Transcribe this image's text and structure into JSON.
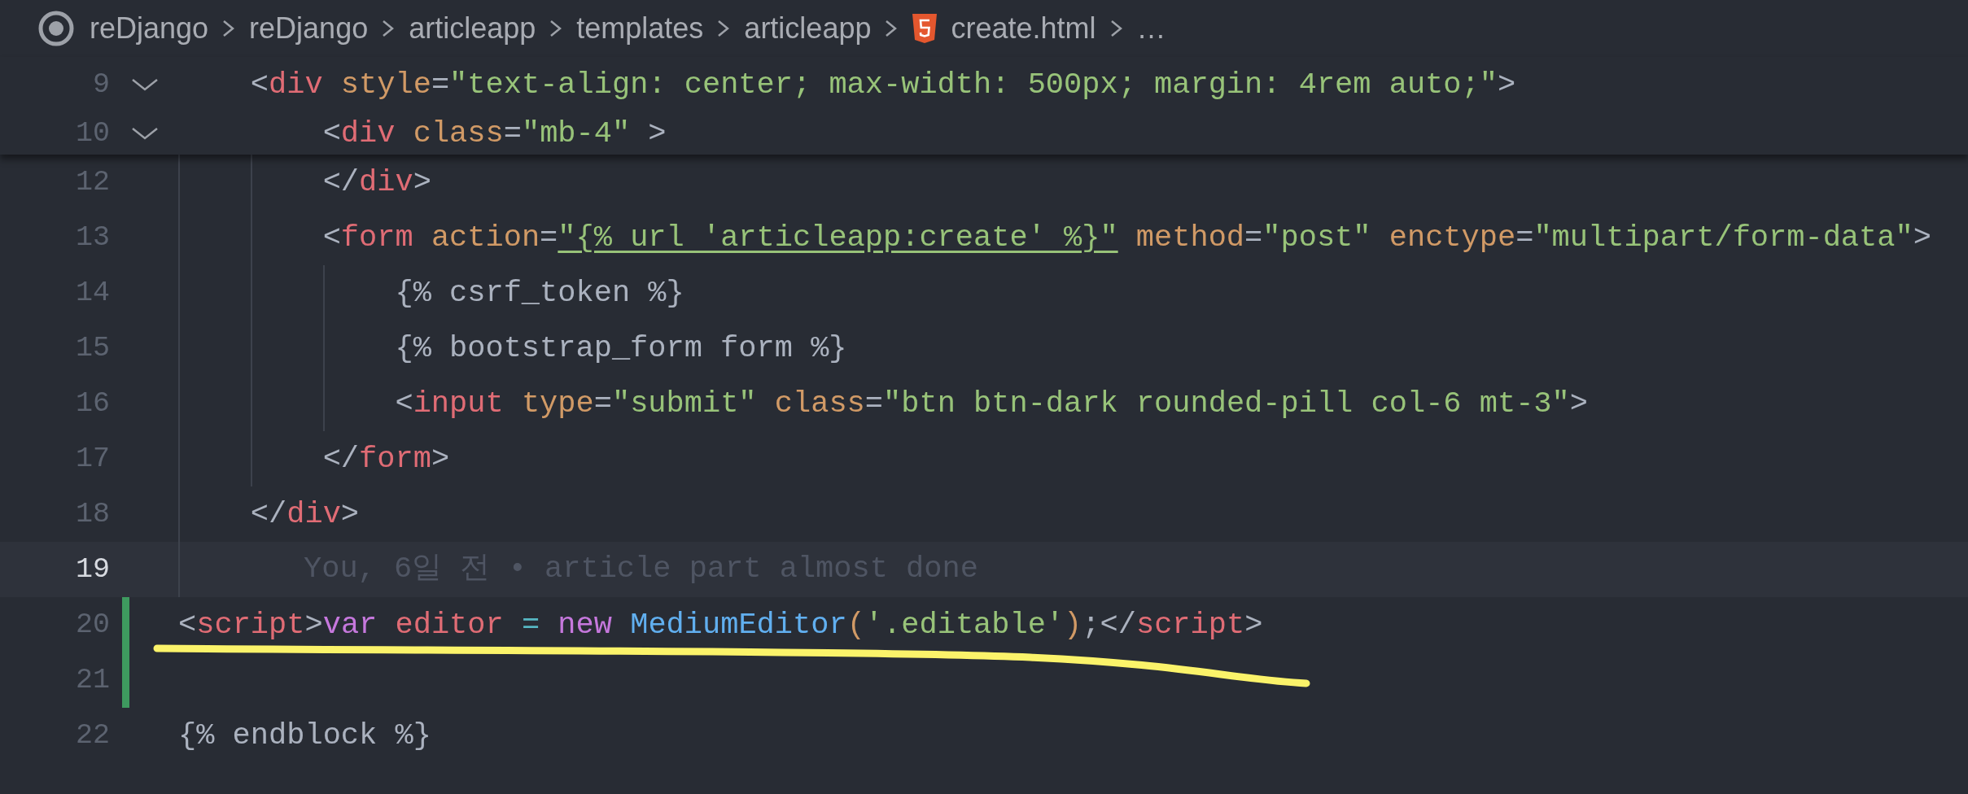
{
  "breadcrumbs": [
    {
      "label": "reDjango",
      "kind": "folder"
    },
    {
      "label": "reDjango",
      "kind": "folder"
    },
    {
      "label": "articleapp",
      "kind": "folder"
    },
    {
      "label": "templates",
      "kind": "folder"
    },
    {
      "label": "articleapp",
      "kind": "folder"
    },
    {
      "label": "create.html",
      "kind": "html"
    },
    {
      "label": "…",
      "kind": "more"
    }
  ],
  "sticky_scroll": [
    {
      "number": "9",
      "foldable": true,
      "tokens": [
        {
          "kind": "punct",
          "text": "    <"
        },
        {
          "kind": "tag",
          "text": "div"
        },
        {
          "kind": "attr",
          "text": " style"
        },
        {
          "kind": "punct",
          "text": "="
        },
        {
          "kind": "string",
          "text": "\"text-align: center; max-width: 500px; margin: 4rem auto;\""
        },
        {
          "kind": "punct",
          "text": ">"
        }
      ]
    },
    {
      "number": "10",
      "foldable": true,
      "tokens": [
        {
          "kind": "punct",
          "text": "        <"
        },
        {
          "kind": "tag",
          "text": "div"
        },
        {
          "kind": "attr",
          "text": " class"
        },
        {
          "kind": "punct",
          "text": "="
        },
        {
          "kind": "string",
          "text": "\"mb-4\""
        },
        {
          "kind": "punct",
          "text": " >"
        }
      ]
    }
  ],
  "lines": [
    {
      "number": "12",
      "current": false,
      "git_added": false,
      "tokens": [
        {
          "kind": "punct",
          "text": "        </"
        },
        {
          "kind": "tag",
          "text": "div"
        },
        {
          "kind": "punct",
          "text": ">"
        }
      ]
    },
    {
      "number": "13",
      "current": false,
      "git_added": false,
      "tokens": [
        {
          "kind": "punct",
          "text": "        <"
        },
        {
          "kind": "tag",
          "text": "form"
        },
        {
          "kind": "attr",
          "text": " action"
        },
        {
          "kind": "punct",
          "text": "="
        },
        {
          "kind": "link",
          "text": "\"{% url 'articleapp:create' %}\""
        },
        {
          "kind": "attr",
          "text": " method"
        },
        {
          "kind": "punct",
          "text": "="
        },
        {
          "kind": "string",
          "text": "\"post\""
        },
        {
          "kind": "attr",
          "text": " enctype"
        },
        {
          "kind": "punct",
          "text": "="
        },
        {
          "kind": "string",
          "text": "\"multipart/form-data\""
        },
        {
          "kind": "punct",
          "text": ">"
        }
      ]
    },
    {
      "number": "14",
      "current": false,
      "git_added": false,
      "tokens": [
        {
          "kind": "template",
          "text": "            {% csrf_token %}"
        }
      ]
    },
    {
      "number": "15",
      "current": false,
      "git_added": false,
      "tokens": [
        {
          "kind": "template",
          "text": "            {% bootstrap_form form %}"
        }
      ]
    },
    {
      "number": "16",
      "current": false,
      "git_added": false,
      "tokens": [
        {
          "kind": "punct",
          "text": "            <"
        },
        {
          "kind": "tag",
          "text": "input"
        },
        {
          "kind": "attr",
          "text": " type"
        },
        {
          "kind": "punct",
          "text": "="
        },
        {
          "kind": "string",
          "text": "\"submit\""
        },
        {
          "kind": "attr",
          "text": " class"
        },
        {
          "kind": "punct",
          "text": "="
        },
        {
          "kind": "string",
          "text": "\"btn btn-dark rounded-pill col-6 mt-3\""
        },
        {
          "kind": "punct",
          "text": ">"
        }
      ]
    },
    {
      "number": "17",
      "current": false,
      "git_added": false,
      "tokens": [
        {
          "kind": "punct",
          "text": "        </"
        },
        {
          "kind": "tag",
          "text": "form"
        },
        {
          "kind": "punct",
          "text": ">"
        }
      ]
    },
    {
      "number": "18",
      "current": false,
      "git_added": false,
      "tokens": [
        {
          "kind": "punct",
          "text": "    </"
        },
        {
          "kind": "tag",
          "text": "div"
        },
        {
          "kind": "punct",
          "text": ">"
        }
      ]
    },
    {
      "number": "19",
      "current": true,
      "git_added": false,
      "blame": "You, 6일 전 • article part almost done"
    },
    {
      "number": "20",
      "current": false,
      "git_added": true,
      "tokens": [
        {
          "kind": "punct",
          "text": "<"
        },
        {
          "kind": "tag",
          "text": "script"
        },
        {
          "kind": "punct",
          "text": ">"
        },
        {
          "kind": "keyword",
          "text": "var"
        },
        {
          "kind": "variable",
          "text": " editor"
        },
        {
          "kind": "operator",
          "text": " ="
        },
        {
          "kind": "keyword",
          "text": " new"
        },
        {
          "kind": "function",
          "text": " MediumEditor"
        },
        {
          "kind": "paren",
          "text": "("
        },
        {
          "kind": "string",
          "text": "'.editable'"
        },
        {
          "kind": "paren",
          "text": ")"
        },
        {
          "kind": "punct",
          "text": ";</"
        },
        {
          "kind": "tag",
          "text": "script"
        },
        {
          "kind": "punct",
          "text": ">"
        }
      ]
    },
    {
      "number": "21",
      "current": false,
      "git_added": true
    },
    {
      "number": "22",
      "current": false,
      "git_added": false,
      "tokens": [
        {
          "kind": "template",
          "text": "{% endblock %}"
        }
      ]
    }
  ]
}
